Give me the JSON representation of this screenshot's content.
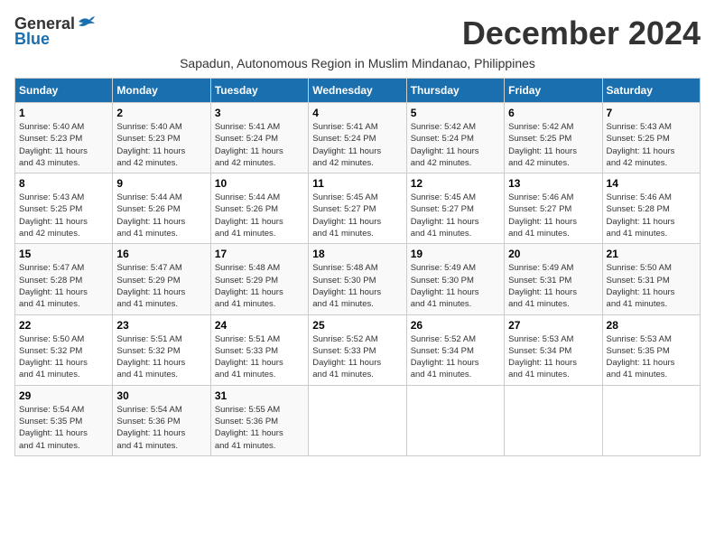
{
  "logo": {
    "general": "General",
    "blue": "Blue"
  },
  "title": "December 2024",
  "location": "Sapadun, Autonomous Region in Muslim Mindanao, Philippines",
  "days_of_week": [
    "Sunday",
    "Monday",
    "Tuesday",
    "Wednesday",
    "Thursday",
    "Friday",
    "Saturday"
  ],
  "weeks": [
    [
      {
        "day": "1",
        "sunrise": "5:40 AM",
        "sunset": "5:23 PM",
        "daylight": "11 hours and 43 minutes."
      },
      {
        "day": "2",
        "sunrise": "5:40 AM",
        "sunset": "5:23 PM",
        "daylight": "11 hours and 42 minutes."
      },
      {
        "day": "3",
        "sunrise": "5:41 AM",
        "sunset": "5:24 PM",
        "daylight": "11 hours and 42 minutes."
      },
      {
        "day": "4",
        "sunrise": "5:41 AM",
        "sunset": "5:24 PM",
        "daylight": "11 hours and 42 minutes."
      },
      {
        "day": "5",
        "sunrise": "5:42 AM",
        "sunset": "5:24 PM",
        "daylight": "11 hours and 42 minutes."
      },
      {
        "day": "6",
        "sunrise": "5:42 AM",
        "sunset": "5:25 PM",
        "daylight": "11 hours and 42 minutes."
      },
      {
        "day": "7",
        "sunrise": "5:43 AM",
        "sunset": "5:25 PM",
        "daylight": "11 hours and 42 minutes."
      }
    ],
    [
      {
        "day": "8",
        "sunrise": "5:43 AM",
        "sunset": "5:25 PM",
        "daylight": "11 hours and 42 minutes."
      },
      {
        "day": "9",
        "sunrise": "5:44 AM",
        "sunset": "5:26 PM",
        "daylight": "11 hours and 41 minutes."
      },
      {
        "day": "10",
        "sunrise": "5:44 AM",
        "sunset": "5:26 PM",
        "daylight": "11 hours and 41 minutes."
      },
      {
        "day": "11",
        "sunrise": "5:45 AM",
        "sunset": "5:27 PM",
        "daylight": "11 hours and 41 minutes."
      },
      {
        "day": "12",
        "sunrise": "5:45 AM",
        "sunset": "5:27 PM",
        "daylight": "11 hours and 41 minutes."
      },
      {
        "day": "13",
        "sunrise": "5:46 AM",
        "sunset": "5:27 PM",
        "daylight": "11 hours and 41 minutes."
      },
      {
        "day": "14",
        "sunrise": "5:46 AM",
        "sunset": "5:28 PM",
        "daylight": "11 hours and 41 minutes."
      }
    ],
    [
      {
        "day": "15",
        "sunrise": "5:47 AM",
        "sunset": "5:28 PM",
        "daylight": "11 hours and 41 minutes."
      },
      {
        "day": "16",
        "sunrise": "5:47 AM",
        "sunset": "5:29 PM",
        "daylight": "11 hours and 41 minutes."
      },
      {
        "day": "17",
        "sunrise": "5:48 AM",
        "sunset": "5:29 PM",
        "daylight": "11 hours and 41 minutes."
      },
      {
        "day": "18",
        "sunrise": "5:48 AM",
        "sunset": "5:30 PM",
        "daylight": "11 hours and 41 minutes."
      },
      {
        "day": "19",
        "sunrise": "5:49 AM",
        "sunset": "5:30 PM",
        "daylight": "11 hours and 41 minutes."
      },
      {
        "day": "20",
        "sunrise": "5:49 AM",
        "sunset": "5:31 PM",
        "daylight": "11 hours and 41 minutes."
      },
      {
        "day": "21",
        "sunrise": "5:50 AM",
        "sunset": "5:31 PM",
        "daylight": "11 hours and 41 minutes."
      }
    ],
    [
      {
        "day": "22",
        "sunrise": "5:50 AM",
        "sunset": "5:32 PM",
        "daylight": "11 hours and 41 minutes."
      },
      {
        "day": "23",
        "sunrise": "5:51 AM",
        "sunset": "5:32 PM",
        "daylight": "11 hours and 41 minutes."
      },
      {
        "day": "24",
        "sunrise": "5:51 AM",
        "sunset": "5:33 PM",
        "daylight": "11 hours and 41 minutes."
      },
      {
        "day": "25",
        "sunrise": "5:52 AM",
        "sunset": "5:33 PM",
        "daylight": "11 hours and 41 minutes."
      },
      {
        "day": "26",
        "sunrise": "5:52 AM",
        "sunset": "5:34 PM",
        "daylight": "11 hours and 41 minutes."
      },
      {
        "day": "27",
        "sunrise": "5:53 AM",
        "sunset": "5:34 PM",
        "daylight": "11 hours and 41 minutes."
      },
      {
        "day": "28",
        "sunrise": "5:53 AM",
        "sunset": "5:35 PM",
        "daylight": "11 hours and 41 minutes."
      }
    ],
    [
      {
        "day": "29",
        "sunrise": "5:54 AM",
        "sunset": "5:35 PM",
        "daylight": "11 hours and 41 minutes."
      },
      {
        "day": "30",
        "sunrise": "5:54 AM",
        "sunset": "5:36 PM",
        "daylight": "11 hours and 41 minutes."
      },
      {
        "day": "31",
        "sunrise": "5:55 AM",
        "sunset": "5:36 PM",
        "daylight": "11 hours and 41 minutes."
      },
      null,
      null,
      null,
      null
    ]
  ],
  "labels": {
    "sunrise": "Sunrise:",
    "sunset": "Sunset:",
    "daylight": "Daylight:"
  }
}
